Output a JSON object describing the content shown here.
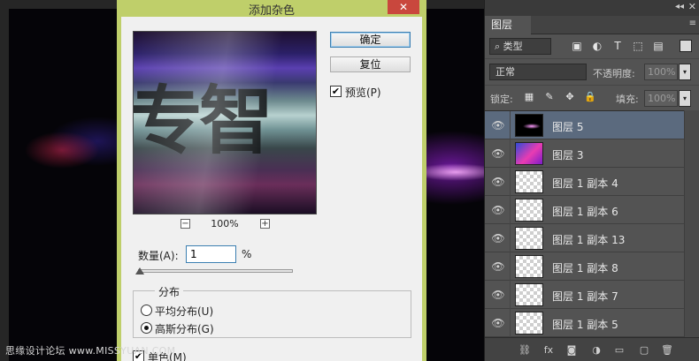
{
  "dialog": {
    "title": "添加杂色",
    "close_glyph": "✕",
    "ok_label": "确定",
    "reset_label": "复位",
    "preview_label": "预览(P)",
    "preview_checked": true,
    "preview_text": "专智",
    "zoom_out": "−",
    "zoom_value": "100%",
    "zoom_in": "+",
    "amount_label": "数量(A):",
    "amount_value": "1",
    "amount_unit": "%",
    "distribution_legend": "分布",
    "uniform_label": "平均分布(U)",
    "gaussian_label": "高斯分布(G)",
    "monochromatic_label": "单色(M)",
    "checkmark": "✔"
  },
  "layers_panel": {
    "tab": "图层",
    "collapse_glyph": "◂◂",
    "close_glyph": "✕",
    "menu_glyph": "≡",
    "filter_type": "⌕ 类型",
    "filter_icons": [
      "▣",
      "◐",
      "T",
      "⬚",
      "▤"
    ],
    "blend_mode": "正常",
    "opacity_label": "不透明度:",
    "opacity_value": "100%",
    "lock_label": "锁定:",
    "lock_icons": [
      "▦",
      "✎",
      "✥",
      "🔒"
    ],
    "fill_label": "填充:",
    "fill_value": "100%",
    "spin_glyph": "▾",
    "eye_glyph": "👁",
    "layers": [
      {
        "name": "图层 5",
        "selected": true
      },
      {
        "name": "图层 3",
        "selected": false
      },
      {
        "name": "图层 1 副本 4",
        "selected": false
      },
      {
        "name": "图层 1 副本 6",
        "selected": false
      },
      {
        "name": "图层 1 副本 13",
        "selected": false
      },
      {
        "name": "图层 1 副本 8",
        "selected": false
      },
      {
        "name": "图层 1 副本 7",
        "selected": false
      },
      {
        "name": "图层 1 副本 5",
        "selected": false
      }
    ],
    "footer_icons": [
      "⛓",
      "fx",
      "◙",
      "◑",
      "▭",
      "▢",
      "🗑"
    ]
  },
  "watermark": "思缘设计论坛 www.MISSYUAN.COM"
}
